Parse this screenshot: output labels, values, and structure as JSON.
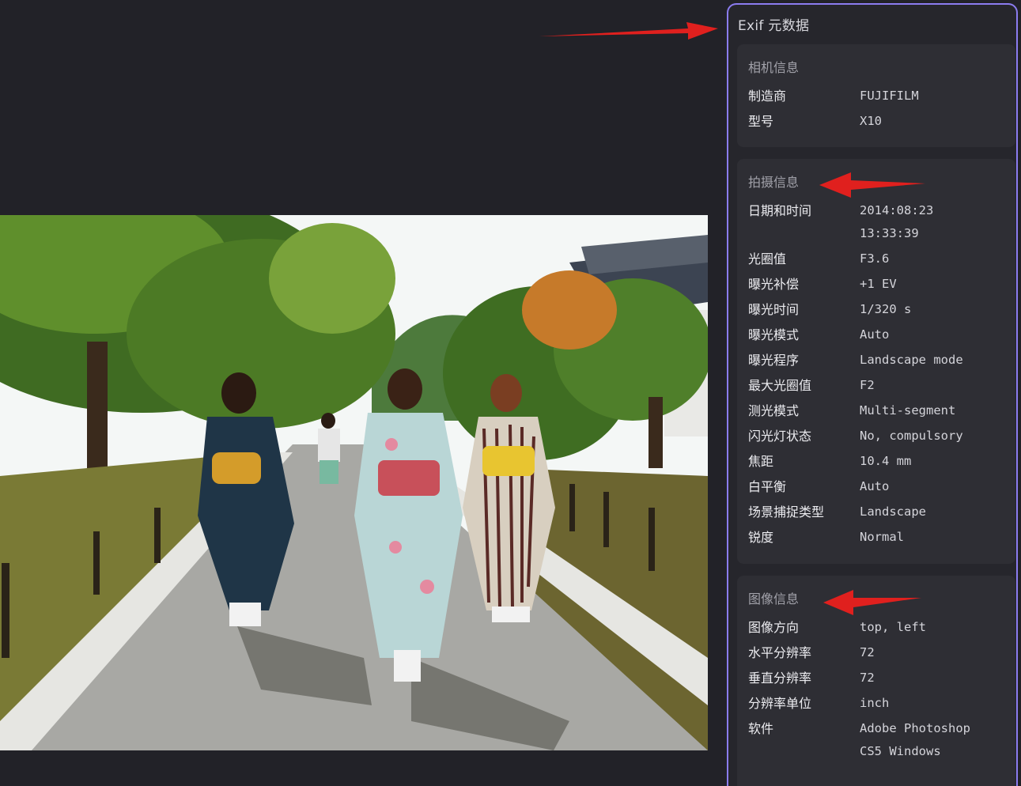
{
  "panel": {
    "title": "Exif 元数据",
    "sections": [
      {
        "title": "相机信息",
        "rows": [
          {
            "key": "制造商",
            "value": "FUJIFILM"
          },
          {
            "key": "型号",
            "value": "X10"
          }
        ]
      },
      {
        "title": "拍摄信息",
        "rows": [
          {
            "key": "日期和时间",
            "value": "2014:08:23\n13:33:39"
          },
          {
            "key": "光圈值",
            "value": "F3.6"
          },
          {
            "key": "曝光补偿",
            "value": "+1 EV"
          },
          {
            "key": "曝光时间",
            "value": "1/320 s"
          },
          {
            "key": "曝光模式",
            "value": "Auto"
          },
          {
            "key": "曝光程序",
            "value": "Landscape mode"
          },
          {
            "key": "最大光圈值",
            "value": "F2"
          },
          {
            "key": "测光模式",
            "value": "Multi-segment"
          },
          {
            "key": "闪光灯状态",
            "value": "No, compulsory"
          },
          {
            "key": "焦距",
            "value": "10.4 mm"
          },
          {
            "key": "白平衡",
            "value": "Auto"
          },
          {
            "key": "场景捕捉类型",
            "value": "Landscape"
          },
          {
            "key": "锐度",
            "value": "Normal"
          }
        ]
      },
      {
        "title": "图像信息",
        "rows": [
          {
            "key": "图像方向",
            "value": "top, left"
          },
          {
            "key": "水平分辨率",
            "value": "72"
          },
          {
            "key": "垂直分辨率",
            "value": "72"
          },
          {
            "key": "分辨率单位",
            "value": "inch"
          },
          {
            "key": "软件",
            "value": "Adobe Photoshop\nCS5 Windows"
          }
        ]
      }
    ]
  },
  "colors": {
    "background": "#222228",
    "panel_border": "#8b7cf0",
    "card_bg": "#2e2e34",
    "annotation_arrow": "#e0201e"
  },
  "icons": [
    "annotation-arrow"
  ]
}
